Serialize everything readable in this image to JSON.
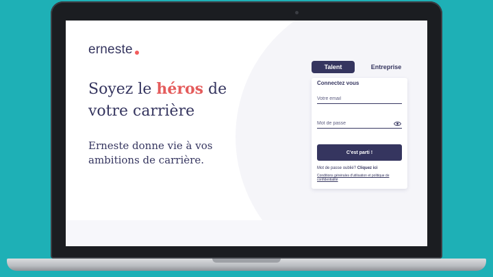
{
  "brand": {
    "name": "erneste",
    "dot_color": "#f25c5c",
    "primary_color": "#35355f",
    "background_color": "#1eb0b6"
  },
  "hero": {
    "title_before": "Soyez le ",
    "title_highlight": "héros",
    "title_after": " de votre carrière",
    "subtitle": "Erneste donne vie à vos ambitions de carrière."
  },
  "tabs": [
    {
      "label": "Talent",
      "active": true
    },
    {
      "label": "Entreprise",
      "active": false
    }
  ],
  "login": {
    "title": "Connectez vous",
    "email_placeholder": "Votre email",
    "password_placeholder": "Mot de passe",
    "password_toggle_icon": "eye-icon",
    "submit_label": "C'est parti !",
    "forgot_text": "Mot de passe oublié?",
    "forgot_link": "Cliquez ici",
    "terms_link": "Conditions générales d'utilisation et politique de confidentialité"
  }
}
